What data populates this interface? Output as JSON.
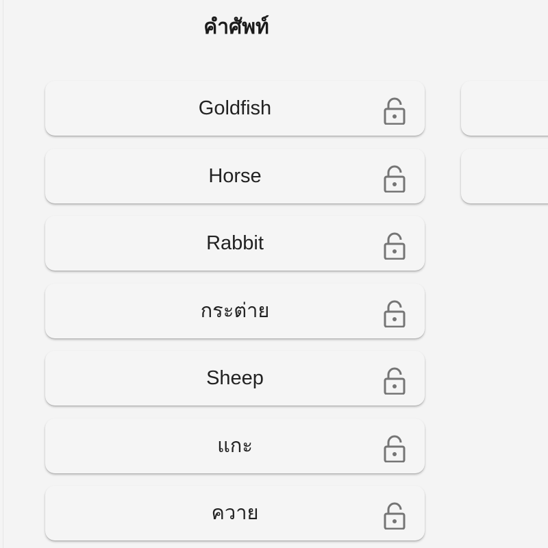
{
  "header": {
    "title": "คำศัพท์"
  },
  "words": [
    {
      "label": "Goldfish",
      "icon": "lock-open-icon"
    },
    {
      "label": "Horse",
      "icon": "lock-open-icon"
    },
    {
      "label": "Rabbit",
      "icon": "lock-open-icon"
    },
    {
      "label": "กระต่าย",
      "icon": "lock-open-icon"
    },
    {
      "label": "Sheep",
      "icon": "lock-open-icon"
    },
    {
      "label": "แกะ",
      "icon": "lock-open-icon"
    },
    {
      "label": "ควาย",
      "icon": "lock-open-icon"
    }
  ],
  "matches": [
    {
      "label": ""
    },
    {
      "label": ""
    }
  ],
  "colors": {
    "background": "#f4f4f4",
    "card": "#f5f5f5",
    "icon": "#757575",
    "text": "#222222"
  }
}
